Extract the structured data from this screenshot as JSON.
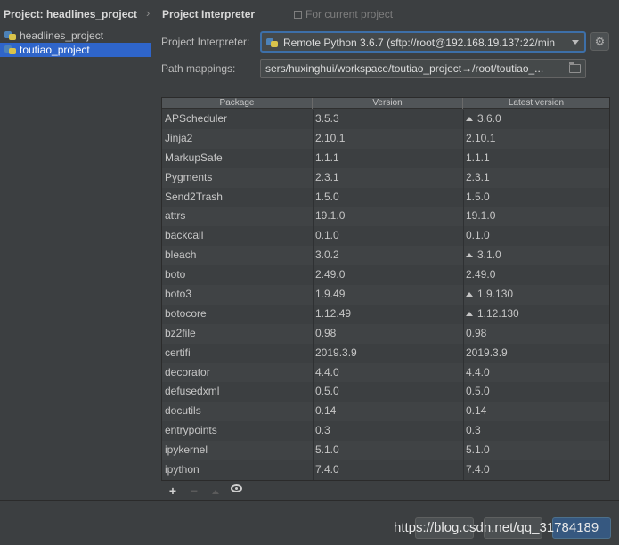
{
  "header": {
    "project_title": "Project: headlines_project",
    "separator": "›",
    "page_title": "Project Interpreter",
    "scope_note": "For current project"
  },
  "sidebar": {
    "items": [
      {
        "label": "headlines_project",
        "selected": false
      },
      {
        "label": "toutiao_project",
        "selected": true
      }
    ]
  },
  "form": {
    "interpreter_label": "Project Interpreter:",
    "interpreter_value": "Remote Python 3.6.7 (sftp://root@192.168.19.137:22/min",
    "path_label": "Path mappings:",
    "path_value": "sers/huxinghui/workspace/toutiao_project→/root/toutiao_..."
  },
  "table": {
    "columns": [
      "Package",
      "Version",
      "Latest version"
    ],
    "rows": [
      {
        "package": "APScheduler",
        "version": "3.5.3",
        "latest": "3.6.0",
        "upgrade": true
      },
      {
        "package": "Jinja2",
        "version": "2.10.1",
        "latest": "2.10.1",
        "upgrade": false
      },
      {
        "package": "MarkupSafe",
        "version": "1.1.1",
        "latest": "1.1.1",
        "upgrade": false
      },
      {
        "package": "Pygments",
        "version": "2.3.1",
        "latest": "2.3.1",
        "upgrade": false
      },
      {
        "package": "Send2Trash",
        "version": "1.5.0",
        "latest": "1.5.0",
        "upgrade": false
      },
      {
        "package": "attrs",
        "version": "19.1.0",
        "latest": "19.1.0",
        "upgrade": false
      },
      {
        "package": "backcall",
        "version": "0.1.0",
        "latest": "0.1.0",
        "upgrade": false
      },
      {
        "package": "bleach",
        "version": "3.0.2",
        "latest": "3.1.0",
        "upgrade": true
      },
      {
        "package": "boto",
        "version": "2.49.0",
        "latest": "2.49.0",
        "upgrade": false
      },
      {
        "package": "boto3",
        "version": "1.9.49",
        "latest": "1.9.130",
        "upgrade": true
      },
      {
        "package": "botocore",
        "version": "1.12.49",
        "latest": "1.12.130",
        "upgrade": true
      },
      {
        "package": "bz2file",
        "version": "0.98",
        "latest": "0.98",
        "upgrade": false
      },
      {
        "package": "certifi",
        "version": "2019.3.9",
        "latest": "2019.3.9",
        "upgrade": false
      },
      {
        "package": "decorator",
        "version": "4.4.0",
        "latest": "4.4.0",
        "upgrade": false
      },
      {
        "package": "defusedxml",
        "version": "0.5.0",
        "latest": "0.5.0",
        "upgrade": false
      },
      {
        "package": "docutils",
        "version": "0.14",
        "latest": "0.14",
        "upgrade": false
      },
      {
        "package": "entrypoints",
        "version": "0.3",
        "latest": "0.3",
        "upgrade": false
      },
      {
        "package": "ipykernel",
        "version": "5.1.0",
        "latest": "5.1.0",
        "upgrade": false
      },
      {
        "package": "ipython",
        "version": "7.4.0",
        "latest": "7.4.0",
        "upgrade": false
      }
    ]
  },
  "toolbar": {
    "add_label": "+",
    "remove_label": "−"
  },
  "watermark": "https://blog.csdn.net/qq_31784189",
  "colors": {
    "background": "#3c3f41",
    "selection": "#2f65ca",
    "focus_border": "#3d6fa8",
    "ok_button": "#365880"
  }
}
